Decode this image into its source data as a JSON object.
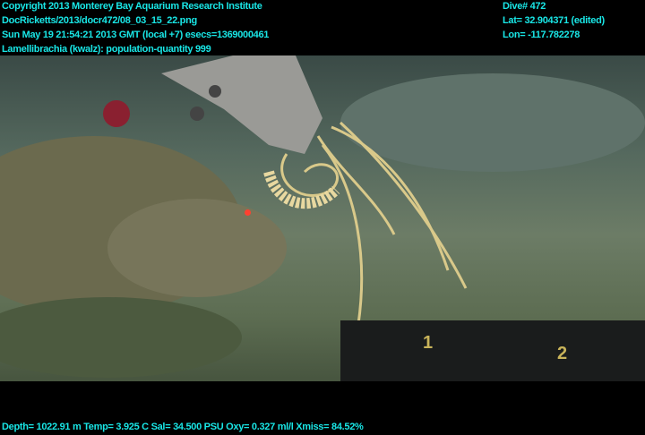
{
  "header_left": [
    "Copyright 2013 Monterey Bay Aquarium Research Institute",
    "DocRicketts/2013/docr472/08_03_15_22.png",
    "Sun May 19 21:54:21 2013 GMT (local +7)  esecs=1369000461",
    "Lamellibrachia (kwalz): population-quantity 999"
  ],
  "header_right": [
    "Dive# 472",
    "Lat= 32.904371 (edited)",
    "Lon= -117.782278"
  ],
  "footer": "Depth= 1022.91 m  Temp= 3.925 C  Sal= 34.500 PSU  Oxy= 0.327 ml/l  Xmiss= 84.52%",
  "scene": {
    "tray_labels": [
      "1",
      "2"
    ]
  },
  "colors": {
    "overlay_text": "#19e6e6"
  }
}
